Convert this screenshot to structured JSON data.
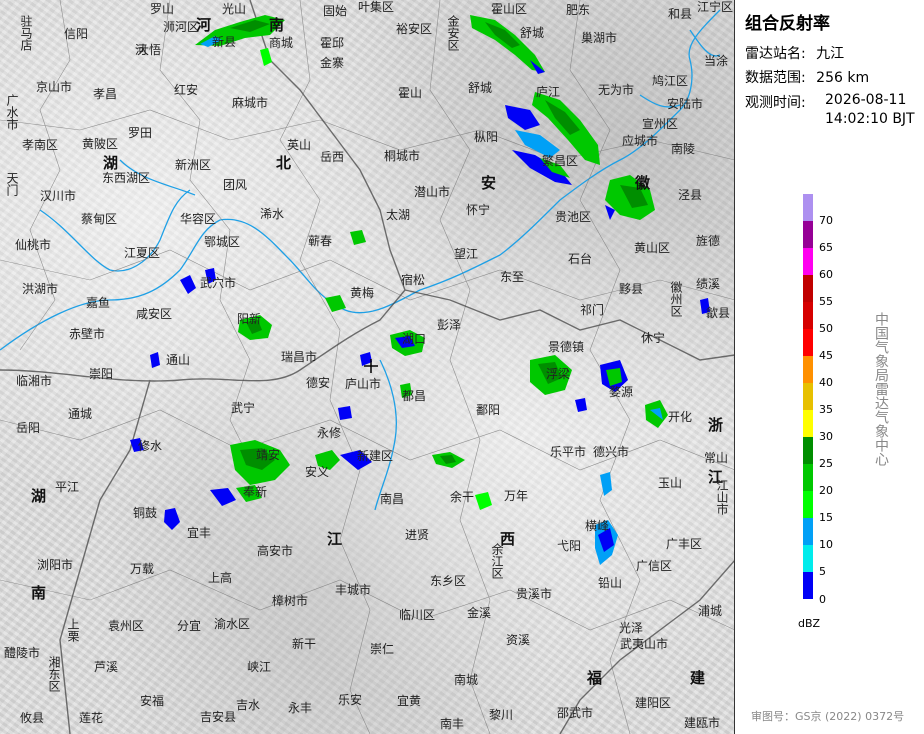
{
  "panel": {
    "title": "组合反射率",
    "station_label": "雷达站名:",
    "station_value": "九江",
    "range_label": "数据范围:",
    "range_value": "256 km",
    "time_label": "观测时间:",
    "time_date": "2026-08-11",
    "time_clock": "14:02:10 BJT",
    "unit": "dBZ",
    "organization": "中国气象局雷达气象中心",
    "audit_number": "审图号：GS京 (2022) 0372号"
  },
  "legend": [
    {
      "label": "70",
      "color": "#ad90f0"
    },
    {
      "label": "65",
      "color": "#960096"
    },
    {
      "label": "60",
      "color": "#ff00f0"
    },
    {
      "label": "55",
      "color": "#c00000"
    },
    {
      "label": "50",
      "color": "#d60000"
    },
    {
      "label": "45",
      "color": "#ff0000"
    },
    {
      "label": "40",
      "color": "#ff9000"
    },
    {
      "label": "35",
      "color": "#e7c000"
    },
    {
      "label": "30",
      "color": "#ffff00"
    },
    {
      "label": "25",
      "color": "#008e00"
    },
    {
      "label": "20",
      "color": "#00c800"
    },
    {
      "label": "15",
      "color": "#00ff00"
    },
    {
      "label": "10",
      "color": "#01a0f6"
    },
    {
      "label": "5",
      "color": "#00ecec"
    },
    {
      "label": "0",
      "color": "#0000f6"
    }
  ],
  "provinces": [
    "湖",
    "北",
    "安",
    "徽",
    "河",
    "南",
    "浙",
    "江",
    "湖",
    "南",
    "江",
    "西",
    "福",
    "建"
  ],
  "cities": [
    "罗山",
    "光山",
    "河",
    "固始",
    "叶集区",
    "霍邱",
    "金安区",
    "霍山区",
    "肥东",
    "和县",
    "江宁区",
    "驻马店",
    "信阳",
    "浉河区",
    "新县",
    "商城",
    "金寨",
    "裕安区",
    "舒城",
    "巢湖市",
    "当涂",
    "京山市",
    "孝昌",
    "大悟",
    "红安",
    "麻城市",
    "霍山",
    "舒城",
    "庐江",
    "无为市",
    "鸠江区",
    "安陆市",
    "广水市",
    "罗田",
    "英山",
    "岳西",
    "桐城市",
    "枞阳",
    "繁昌区",
    "宣州区",
    "应城市",
    "孝南区",
    "黄陂区",
    "新洲区",
    "团风",
    "浠水",
    "潜山市",
    "怀宁",
    "贵池区",
    "南陵",
    "泾县",
    "天门",
    "汉川市",
    "东西湖区",
    "蕲春",
    "太湖",
    "宿松",
    "望江",
    "东至",
    "石台",
    "黄山区",
    "旌德",
    "仙桃市",
    "蔡甸区",
    "江夏区",
    "华容区",
    "鄂城区",
    "武穴市",
    "黄梅",
    "彭泽",
    "祁门",
    "黟县",
    "徽州区",
    "歙县",
    "洪湖市",
    "嘉鱼",
    "咸安区",
    "阳新",
    "湖口",
    "都昌",
    "鄱阳",
    "浮梁",
    "休宁",
    "绩溪",
    "赤壁市",
    "通山",
    "瑞昌市",
    "德安",
    "庐山市",
    "景德镇",
    "婺源",
    "开化",
    "临湘市",
    "崇阳",
    "修水",
    "武宁",
    "永修",
    "乐平市",
    "德兴市",
    "常山",
    "岳阳",
    "通城",
    "靖安",
    "安义",
    "新建区",
    "万年",
    "玉山",
    "江山市",
    "平江",
    "奉新",
    "南昌",
    "余干",
    "横峰",
    "广丰区",
    "铜鼓",
    "宜丰",
    "进贤",
    "余江区",
    "弋阳",
    "广信区",
    "浏阳市",
    "高安市",
    "东乡区",
    "贵溪市",
    "铅山",
    "万载",
    "上高",
    "樟树市",
    "丰城市",
    "临川区",
    "金溪",
    "资溪",
    "浦城",
    "上栗",
    "袁州区",
    "分宜",
    "渝水区",
    "新干",
    "崇仁",
    "光泽",
    "武夷山市",
    "醴陵市",
    "湘东区",
    "芦溪",
    "峡江",
    "宜黄",
    "南城",
    "建阳区",
    "安福",
    "吉水",
    "永丰",
    "乐安",
    "黎川",
    "邵武市",
    "建瓯市",
    "攸县",
    "莲花",
    "吉安县",
    "南丰",
    "九江"
  ],
  "radar_station": "九江"
}
